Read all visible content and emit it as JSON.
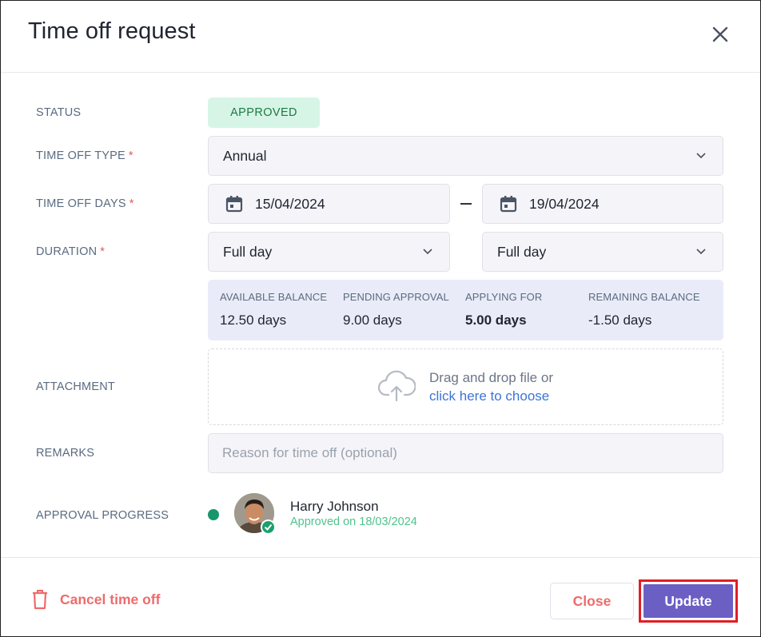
{
  "header": {
    "title": "Time off request"
  },
  "labels": {
    "status": "STATUS",
    "type": "TIME OFF TYPE",
    "days": "TIME OFF DAYS",
    "duration": "DURATION",
    "attachment": "ATTACHMENT",
    "remarks": "REMARKS",
    "approval": "APPROVAL PROGRESS",
    "required_mark": "*"
  },
  "status": {
    "value": "APPROVED"
  },
  "time_off_type": {
    "value": "Annual"
  },
  "dates": {
    "start": "15/04/2024",
    "end": "19/04/2024"
  },
  "duration": {
    "start": "Full day",
    "end": "Full day"
  },
  "balance": [
    {
      "heading": "AVAILABLE BALANCE",
      "value": "12.50 days"
    },
    {
      "heading": "PENDING APPROVAL",
      "value": "9.00 days"
    },
    {
      "heading": "APPLYING FOR",
      "value": "5.00 days"
    },
    {
      "heading": "REMAINING BALANCE",
      "value": "-1.50 days"
    }
  ],
  "attachment": {
    "line1": "Drag and drop file or",
    "link": "click here to choose"
  },
  "remarks": {
    "value": "",
    "placeholder": "Reason for time off (optional)"
  },
  "approver": {
    "name": "Harry Johnson",
    "status": "Approved on 18/03/2024"
  },
  "footer": {
    "cancel_label": "Cancel time off",
    "close_label": "Close",
    "update_label": "Update"
  },
  "colors": {
    "accent": "#6b5fc4",
    "danger": "#ee6b6b",
    "success": "#17966a",
    "highlight_border": "#e01e25"
  }
}
